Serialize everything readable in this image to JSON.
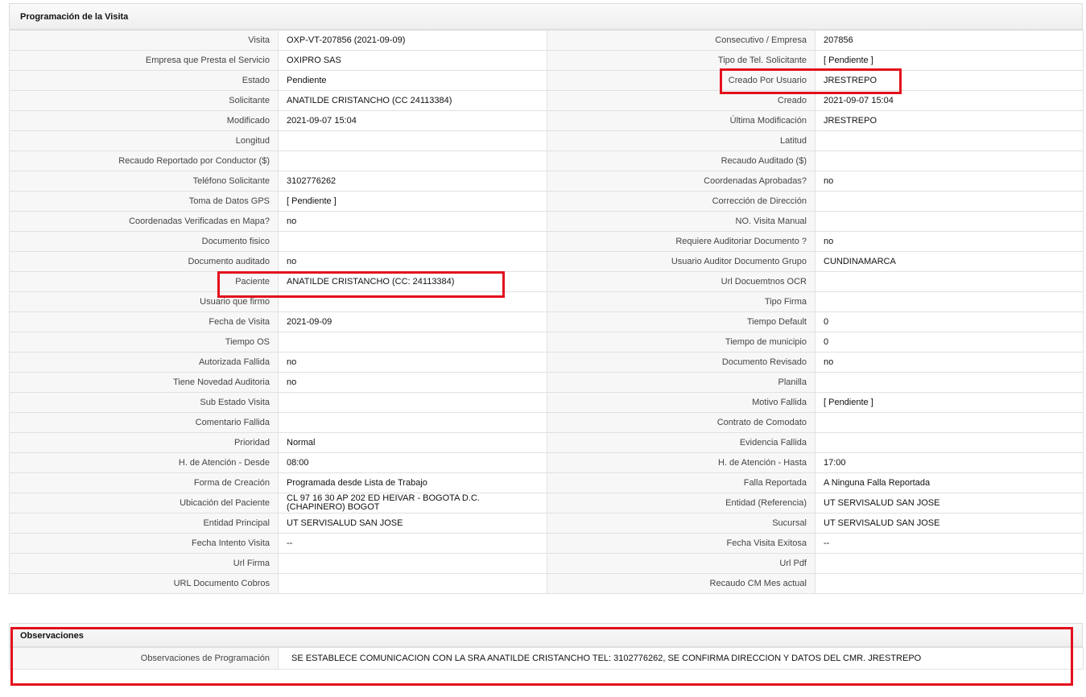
{
  "programacion": {
    "title": "Programación de la Visita",
    "rows": [
      {
        "l1": "Visita",
        "v1": "OXP-VT-207856 (2021-09-09)",
        "l2": "Consecutivo / Empresa",
        "v2": "207856"
      },
      {
        "l1": "Empresa que Presta el Servicio",
        "v1": "OXIPRO SAS",
        "l2": "Tipo de Tel. Solicitante",
        "v2": "[ Pendiente ]"
      },
      {
        "l1": "Estado",
        "v1": "Pendiente",
        "l2": "Creado Por Usuario",
        "v2": "JRESTREPO"
      },
      {
        "l1": "Solicitante",
        "v1": "ANATILDE CRISTANCHO (CC 24113384)",
        "l2": "Creado",
        "v2": "2021-09-07 15:04"
      },
      {
        "l1": "Modificado",
        "v1": "2021-09-07 15:04",
        "l2": "Última Modificación",
        "v2": "JRESTREPO"
      },
      {
        "l1": "Longitud",
        "v1": "",
        "l2": "Latitud",
        "v2": ""
      },
      {
        "l1": "Recaudo Reportado por Conductor ($)",
        "v1": "",
        "l2": "Recaudo Auditado ($)",
        "v2": ""
      },
      {
        "l1": "Teléfono Solicitante",
        "v1": "3102776262",
        "l2": "Coordenadas Aprobadas?",
        "v2": "no"
      },
      {
        "l1": "Toma de Datos GPS",
        "v1": "[ Pendiente ]",
        "l2": "Corrección de Dirección",
        "v2": ""
      },
      {
        "l1": "Coordenadas Verificadas en Mapa?",
        "v1": "no",
        "l2": "NO. Visita Manual",
        "v2": ""
      },
      {
        "l1": "Documento fisico",
        "v1": "",
        "l2": "Requiere Auditoriar Documento ?",
        "v2": "no"
      },
      {
        "l1": "Documento auditado",
        "v1": "no",
        "l2": "Usuario Auditor Documento Grupo",
        "v2": "CUNDINAMARCA"
      },
      {
        "l1": "Paciente",
        "v1": "ANATILDE CRISTANCHO (CC: 24113384)",
        "l2": "Url Docuemtnos OCR",
        "v2": ""
      },
      {
        "l1": "Usuario que firmo",
        "v1": "",
        "l2": "Tipo Firma",
        "v2": ""
      },
      {
        "l1": "Fecha de Visita",
        "v1": "2021-09-09",
        "l2": "Tiempo Default",
        "v2": "0"
      },
      {
        "l1": "Tiempo OS",
        "v1": "",
        "l2": "Tiempo de municipio",
        "v2": "0"
      },
      {
        "l1": "Autorizada Fallida",
        "v1": "no",
        "l2": "Documento Revisado",
        "v2": "no"
      },
      {
        "l1": "Tiene Novedad Auditoria",
        "v1": "no",
        "l2": "Planilla",
        "v2": ""
      },
      {
        "l1": "Sub Estado Visita",
        "v1": "",
        "l2": "Motivo Fallida",
        "v2": "[ Pendiente ]"
      },
      {
        "l1": "Comentario Fallida",
        "v1": "",
        "l2": "Contrato de Comodato",
        "v2": ""
      },
      {
        "l1": "Prioridad",
        "v1": "Normal",
        "l2": "Evidencia Fallida",
        "v2": ""
      },
      {
        "l1": "H. de Atención - Desde",
        "v1": "08:00",
        "l2": "H. de Atención - Hasta",
        "v2": "17:00"
      },
      {
        "l1": "Forma de Creación",
        "v1": "Programada desde Lista de Trabajo",
        "l2": "Falla Reportada",
        "v2": "A Ninguna Falla Reportada"
      },
      {
        "l1": "Ubicación del Paciente",
        "v1": "CL 97 16 30 AP 202 ED HEIVAR - BOGOTA D.C. (CHAPINERO) BOGOT",
        "l2": "Entidad (Referencia)",
        "v2": "UT SERVISALUD SAN JOSE"
      },
      {
        "l1": "Entidad Principal",
        "v1": "UT SERVISALUD SAN JOSE",
        "l2": "Sucursal",
        "v2": "UT SERVISALUD SAN JOSE"
      },
      {
        "l1": "Fecha Intento Visita",
        "v1": "--",
        "l2": "Fecha Visita Exitosa",
        "v2": "--"
      },
      {
        "l1": "Url Firma",
        "v1": "",
        "l2": "Url Pdf",
        "v2": ""
      },
      {
        "l1": "URL Documento Cobros",
        "v1": "",
        "l2": "Recaudo CM Mes actual",
        "v2": ""
      }
    ]
  },
  "observaciones": {
    "title": "Observaciones",
    "label": "Observaciones de Programación",
    "value": "SE ESTABLECE COMUNICACION CON LA SRA ANATILDE CRISTANCHO TEL: 3102776262, SE CONFIRMA DIRECCION Y DATOS DEL CMR. JRESTREPO"
  },
  "colors": {
    "highlight": "#e3101c",
    "label_bg": "#f7f7f7",
    "border": "#e1e1e1"
  }
}
